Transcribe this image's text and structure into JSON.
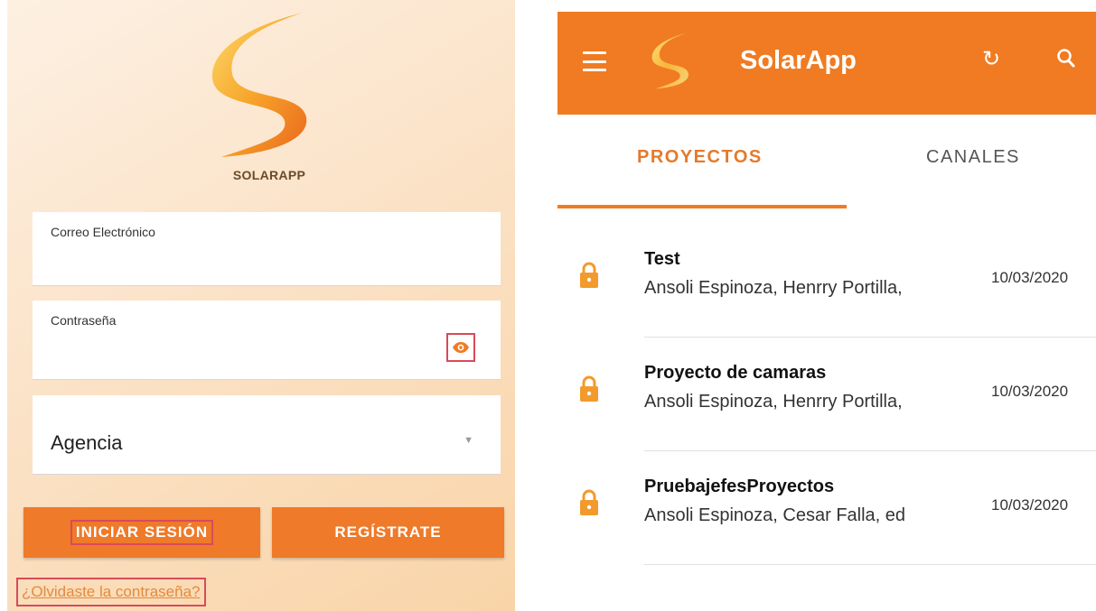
{
  "login": {
    "logo_caption": "SOLARAPP",
    "email_label": "Correo Electrónico",
    "email_value": "",
    "password_label": "Contraseña",
    "password_value": "",
    "show_password_icon": "eye-icon",
    "agency_value": "Agencia",
    "agency_dropdown_icon": "chevron-down-icon",
    "login_button": "INICIAR SESIÓN",
    "register_button": "REGÍSTRATE",
    "forgot_link": "¿Olvidaste la contraseña?"
  },
  "app": {
    "title": "SolarApp",
    "menu_icon": "menu-icon",
    "refresh_icon": "refresh-icon",
    "search_icon": "search-icon",
    "tabs": [
      {
        "label": "PROYECTOS",
        "active": true
      },
      {
        "label": "CANALES",
        "active": false
      }
    ],
    "projects": [
      {
        "title": "Test",
        "members": "Ansoli Espinoza, Henrry Portilla,",
        "date": "10/03/2020",
        "icon": "lock-icon"
      },
      {
        "title": "Proyecto de camaras",
        "members": "Ansoli Espinoza, Henrry Portilla,",
        "date": "10/03/2020",
        "icon": "lock-icon"
      },
      {
        "title": "PruebajefesProyectos",
        "members": "Ansoli Espinoza, Cesar Falla, ed",
        "date": "10/03/2020",
        "icon": "lock-icon"
      }
    ]
  },
  "colors": {
    "brand_orange": "#f07b22",
    "button_orange": "#ee7a2a",
    "highlight_red": "#d94a5a",
    "link_orange": "#e58a3c"
  }
}
